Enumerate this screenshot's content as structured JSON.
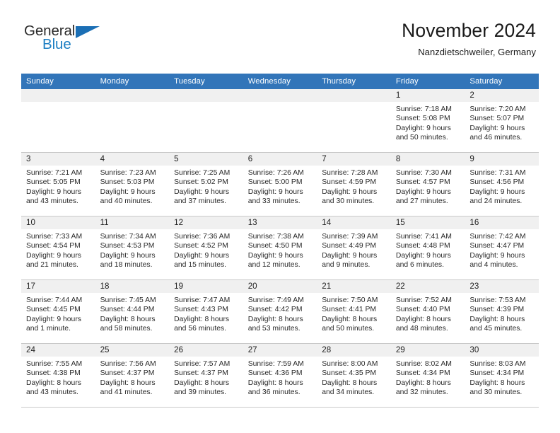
{
  "brand": {
    "word_general": "General",
    "word_blue": "Blue",
    "accent_color": "#1b6fb5"
  },
  "header": {
    "title": "November 2024",
    "location": "Nanzdietschweiler, Germany"
  },
  "calendar": {
    "header_bg": "#3275b9",
    "date_band_bg": "#f0f0f0",
    "weekday_headers": [
      "Sunday",
      "Monday",
      "Tuesday",
      "Wednesday",
      "Thursday",
      "Friday",
      "Saturday"
    ],
    "weeks": [
      [
        {
          "day": "",
          "empty": true
        },
        {
          "day": "",
          "empty": true
        },
        {
          "day": "",
          "empty": true
        },
        {
          "day": "",
          "empty": true
        },
        {
          "day": "",
          "empty": true
        },
        {
          "day": "1",
          "sunrise": "Sunrise: 7:18 AM",
          "sunset": "Sunset: 5:08 PM",
          "daylight_1": "Daylight: 9 hours",
          "daylight_2": "and 50 minutes."
        },
        {
          "day": "2",
          "sunrise": "Sunrise: 7:20 AM",
          "sunset": "Sunset: 5:07 PM",
          "daylight_1": "Daylight: 9 hours",
          "daylight_2": "and 46 minutes."
        }
      ],
      [
        {
          "day": "3",
          "sunrise": "Sunrise: 7:21 AM",
          "sunset": "Sunset: 5:05 PM",
          "daylight_1": "Daylight: 9 hours",
          "daylight_2": "and 43 minutes."
        },
        {
          "day": "4",
          "sunrise": "Sunrise: 7:23 AM",
          "sunset": "Sunset: 5:03 PM",
          "daylight_1": "Daylight: 9 hours",
          "daylight_2": "and 40 minutes."
        },
        {
          "day": "5",
          "sunrise": "Sunrise: 7:25 AM",
          "sunset": "Sunset: 5:02 PM",
          "daylight_1": "Daylight: 9 hours",
          "daylight_2": "and 37 minutes."
        },
        {
          "day": "6",
          "sunrise": "Sunrise: 7:26 AM",
          "sunset": "Sunset: 5:00 PM",
          "daylight_1": "Daylight: 9 hours",
          "daylight_2": "and 33 minutes."
        },
        {
          "day": "7",
          "sunrise": "Sunrise: 7:28 AM",
          "sunset": "Sunset: 4:59 PM",
          "daylight_1": "Daylight: 9 hours",
          "daylight_2": "and 30 minutes."
        },
        {
          "day": "8",
          "sunrise": "Sunrise: 7:30 AM",
          "sunset": "Sunset: 4:57 PM",
          "daylight_1": "Daylight: 9 hours",
          "daylight_2": "and 27 minutes."
        },
        {
          "day": "9",
          "sunrise": "Sunrise: 7:31 AM",
          "sunset": "Sunset: 4:56 PM",
          "daylight_1": "Daylight: 9 hours",
          "daylight_2": "and 24 minutes."
        }
      ],
      [
        {
          "day": "10",
          "sunrise": "Sunrise: 7:33 AM",
          "sunset": "Sunset: 4:54 PM",
          "daylight_1": "Daylight: 9 hours",
          "daylight_2": "and 21 minutes."
        },
        {
          "day": "11",
          "sunrise": "Sunrise: 7:34 AM",
          "sunset": "Sunset: 4:53 PM",
          "daylight_1": "Daylight: 9 hours",
          "daylight_2": "and 18 minutes."
        },
        {
          "day": "12",
          "sunrise": "Sunrise: 7:36 AM",
          "sunset": "Sunset: 4:52 PM",
          "daylight_1": "Daylight: 9 hours",
          "daylight_2": "and 15 minutes."
        },
        {
          "day": "13",
          "sunrise": "Sunrise: 7:38 AM",
          "sunset": "Sunset: 4:50 PM",
          "daylight_1": "Daylight: 9 hours",
          "daylight_2": "and 12 minutes."
        },
        {
          "day": "14",
          "sunrise": "Sunrise: 7:39 AM",
          "sunset": "Sunset: 4:49 PM",
          "daylight_1": "Daylight: 9 hours",
          "daylight_2": "and 9 minutes."
        },
        {
          "day": "15",
          "sunrise": "Sunrise: 7:41 AM",
          "sunset": "Sunset: 4:48 PM",
          "daylight_1": "Daylight: 9 hours",
          "daylight_2": "and 6 minutes."
        },
        {
          "day": "16",
          "sunrise": "Sunrise: 7:42 AM",
          "sunset": "Sunset: 4:47 PM",
          "daylight_1": "Daylight: 9 hours",
          "daylight_2": "and 4 minutes."
        }
      ],
      [
        {
          "day": "17",
          "sunrise": "Sunrise: 7:44 AM",
          "sunset": "Sunset: 4:45 PM",
          "daylight_1": "Daylight: 9 hours",
          "daylight_2": "and 1 minute."
        },
        {
          "day": "18",
          "sunrise": "Sunrise: 7:45 AM",
          "sunset": "Sunset: 4:44 PM",
          "daylight_1": "Daylight: 8 hours",
          "daylight_2": "and 58 minutes."
        },
        {
          "day": "19",
          "sunrise": "Sunrise: 7:47 AM",
          "sunset": "Sunset: 4:43 PM",
          "daylight_1": "Daylight: 8 hours",
          "daylight_2": "and 56 minutes."
        },
        {
          "day": "20",
          "sunrise": "Sunrise: 7:49 AM",
          "sunset": "Sunset: 4:42 PM",
          "daylight_1": "Daylight: 8 hours",
          "daylight_2": "and 53 minutes."
        },
        {
          "day": "21",
          "sunrise": "Sunrise: 7:50 AM",
          "sunset": "Sunset: 4:41 PM",
          "daylight_1": "Daylight: 8 hours",
          "daylight_2": "and 50 minutes."
        },
        {
          "day": "22",
          "sunrise": "Sunrise: 7:52 AM",
          "sunset": "Sunset: 4:40 PM",
          "daylight_1": "Daylight: 8 hours",
          "daylight_2": "and 48 minutes."
        },
        {
          "day": "23",
          "sunrise": "Sunrise: 7:53 AM",
          "sunset": "Sunset: 4:39 PM",
          "daylight_1": "Daylight: 8 hours",
          "daylight_2": "and 45 minutes."
        }
      ],
      [
        {
          "day": "24",
          "sunrise": "Sunrise: 7:55 AM",
          "sunset": "Sunset: 4:38 PM",
          "daylight_1": "Daylight: 8 hours",
          "daylight_2": "and 43 minutes."
        },
        {
          "day": "25",
          "sunrise": "Sunrise: 7:56 AM",
          "sunset": "Sunset: 4:37 PM",
          "daylight_1": "Daylight: 8 hours",
          "daylight_2": "and 41 minutes."
        },
        {
          "day": "26",
          "sunrise": "Sunrise: 7:57 AM",
          "sunset": "Sunset: 4:37 PM",
          "daylight_1": "Daylight: 8 hours",
          "daylight_2": "and 39 minutes."
        },
        {
          "day": "27",
          "sunrise": "Sunrise: 7:59 AM",
          "sunset": "Sunset: 4:36 PM",
          "daylight_1": "Daylight: 8 hours",
          "daylight_2": "and 36 minutes."
        },
        {
          "day": "28",
          "sunrise": "Sunrise: 8:00 AM",
          "sunset": "Sunset: 4:35 PM",
          "daylight_1": "Daylight: 8 hours",
          "daylight_2": "and 34 minutes."
        },
        {
          "day": "29",
          "sunrise": "Sunrise: 8:02 AM",
          "sunset": "Sunset: 4:34 PM",
          "daylight_1": "Daylight: 8 hours",
          "daylight_2": "and 32 minutes."
        },
        {
          "day": "30",
          "sunrise": "Sunrise: 8:03 AM",
          "sunset": "Sunset: 4:34 PM",
          "daylight_1": "Daylight: 8 hours",
          "daylight_2": "and 30 minutes."
        }
      ]
    ]
  }
}
